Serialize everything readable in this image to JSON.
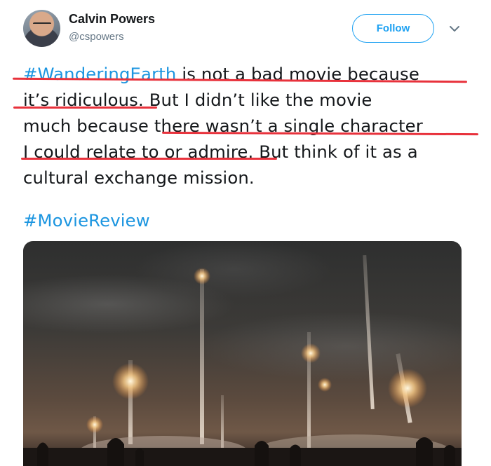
{
  "user": {
    "name": "Calvin Powers",
    "handle": "@cspowers",
    "follow_label": "Follow"
  },
  "tweet": {
    "lines": [
      [
        {
          "text": "#WanderingEarth",
          "link": true
        },
        {
          "text": " is not a bad movie because",
          "link": false
        }
      ],
      [
        {
          "text": "it’s ridiculous. But I didn’t like the movie",
          "link": false
        }
      ],
      [
        {
          "text": "much because there wasn’t a single character",
          "link": false
        }
      ],
      [
        {
          "text": "I could relate to or admire. But think of it as a",
          "link": false
        }
      ],
      [
        {
          "text": "cultural exchange mission.",
          "link": false
        }
      ]
    ],
    "hashtag": "#MovieReview"
  },
  "colors": {
    "link": "#1b95e0",
    "follow": "#1da1f2",
    "underline_marker": "#e8323c"
  },
  "icons": {
    "caret": "chevron-down-icon"
  }
}
